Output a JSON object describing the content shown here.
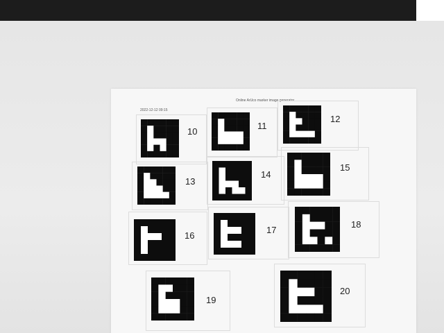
{
  "paper": {
    "header_left": "2022-12-12 09:15",
    "header_right": "Online ArUco marker image generator"
  },
  "markers": [
    {
      "label": "10",
      "grid": [
        [
          1,
          1,
          1,
          1,
          1,
          1
        ],
        [
          1,
          0,
          1,
          1,
          1,
          1
        ],
        [
          1,
          0,
          1,
          1,
          1,
          1
        ],
        [
          1,
          0,
          0,
          0,
          1,
          1
        ],
        [
          1,
          0,
          1,
          0,
          1,
          1
        ],
        [
          1,
          1,
          1,
          1,
          1,
          1
        ]
      ]
    },
    {
      "label": "11",
      "grid": [
        [
          1,
          1,
          1,
          1,
          1,
          1
        ],
        [
          1,
          0,
          1,
          1,
          1,
          1
        ],
        [
          1,
          0,
          1,
          1,
          1,
          1
        ],
        [
          1,
          0,
          0,
          0,
          0,
          1
        ],
        [
          1,
          0,
          0,
          0,
          0,
          1
        ],
        [
          1,
          1,
          1,
          1,
          1,
          1
        ]
      ]
    },
    {
      "label": "12",
      "grid": [
        [
          1,
          1,
          1,
          1,
          1,
          1
        ],
        [
          1,
          0,
          1,
          1,
          1,
          1
        ],
        [
          1,
          0,
          0,
          1,
          1,
          1
        ],
        [
          1,
          0,
          1,
          1,
          1,
          1
        ],
        [
          1,
          0,
          0,
          0,
          0,
          1
        ],
        [
          1,
          1,
          1,
          1,
          1,
          1
        ]
      ]
    },
    {
      "label": "13",
      "grid": [
        [
          1,
          1,
          1,
          1,
          1,
          1
        ],
        [
          1,
          0,
          1,
          1,
          1,
          1
        ],
        [
          1,
          0,
          0,
          1,
          1,
          1
        ],
        [
          1,
          0,
          0,
          0,
          1,
          1
        ],
        [
          1,
          0,
          0,
          0,
          0,
          1
        ],
        [
          1,
          1,
          1,
          1,
          1,
          1
        ]
      ]
    },
    {
      "label": "14",
      "grid": [
        [
          1,
          1,
          1,
          1,
          1,
          1
        ],
        [
          1,
          0,
          1,
          1,
          1,
          1
        ],
        [
          1,
          0,
          1,
          1,
          1,
          1
        ],
        [
          1,
          0,
          0,
          0,
          1,
          1
        ],
        [
          1,
          0,
          1,
          0,
          0,
          1
        ],
        [
          1,
          1,
          1,
          1,
          1,
          1
        ]
      ]
    },
    {
      "label": "15",
      "grid": [
        [
          1,
          1,
          1,
          1,
          1,
          1
        ],
        [
          1,
          0,
          1,
          1,
          1,
          1
        ],
        [
          1,
          0,
          1,
          1,
          1,
          1
        ],
        [
          1,
          0,
          0,
          0,
          0,
          1
        ],
        [
          1,
          0,
          0,
          0,
          0,
          1
        ],
        [
          1,
          1,
          1,
          1,
          1,
          1
        ]
      ]
    },
    {
      "label": "16",
      "grid": [
        [
          1,
          1,
          1,
          1,
          1,
          1
        ],
        [
          1,
          0,
          1,
          1,
          1,
          1
        ],
        [
          1,
          0,
          0,
          0,
          1,
          1
        ],
        [
          1,
          0,
          1,
          1,
          1,
          1
        ],
        [
          1,
          0,
          1,
          1,
          1,
          1
        ],
        [
          1,
          1,
          1,
          1,
          1,
          1
        ]
      ]
    },
    {
      "label": "17",
      "grid": [
        [
          1,
          1,
          1,
          1,
          1,
          1
        ],
        [
          1,
          0,
          1,
          1,
          1,
          1
        ],
        [
          1,
          0,
          0,
          0,
          1,
          1
        ],
        [
          1,
          0,
          1,
          1,
          1,
          1
        ],
        [
          1,
          0,
          0,
          0,
          1,
          1
        ],
        [
          1,
          1,
          1,
          1,
          1,
          1
        ]
      ]
    },
    {
      "label": "18",
      "grid": [
        [
          1,
          1,
          1,
          1,
          1,
          1
        ],
        [
          1,
          0,
          1,
          1,
          1,
          1
        ],
        [
          1,
          0,
          0,
          0,
          1,
          1
        ],
        [
          1,
          0,
          1,
          1,
          1,
          1
        ],
        [
          1,
          0,
          0,
          1,
          0,
          1
        ],
        [
          1,
          1,
          1,
          1,
          1,
          1
        ]
      ]
    },
    {
      "label": "19",
      "grid": [
        [
          1,
          1,
          1,
          1,
          1,
          1
        ],
        [
          1,
          0,
          0,
          1,
          1,
          1
        ],
        [
          1,
          0,
          1,
          1,
          1,
          1
        ],
        [
          1,
          0,
          0,
          0,
          1,
          1
        ],
        [
          1,
          0,
          0,
          0,
          1,
          1
        ],
        [
          1,
          1,
          1,
          1,
          1,
          1
        ]
      ]
    },
    {
      "label": "20",
      "grid": [
        [
          1,
          1,
          1,
          1,
          1,
          1
        ],
        [
          1,
          0,
          1,
          1,
          1,
          1
        ],
        [
          1,
          0,
          0,
          0,
          1,
          1
        ],
        [
          1,
          0,
          1,
          1,
          1,
          1
        ],
        [
          1,
          0,
          0,
          0,
          0,
          1
        ],
        [
          1,
          1,
          1,
          1,
          1,
          1
        ]
      ]
    }
  ],
  "colors": {
    "marker": "#0d0d0d",
    "paper": "#f7f7f7",
    "table": "#e8e8e8"
  }
}
